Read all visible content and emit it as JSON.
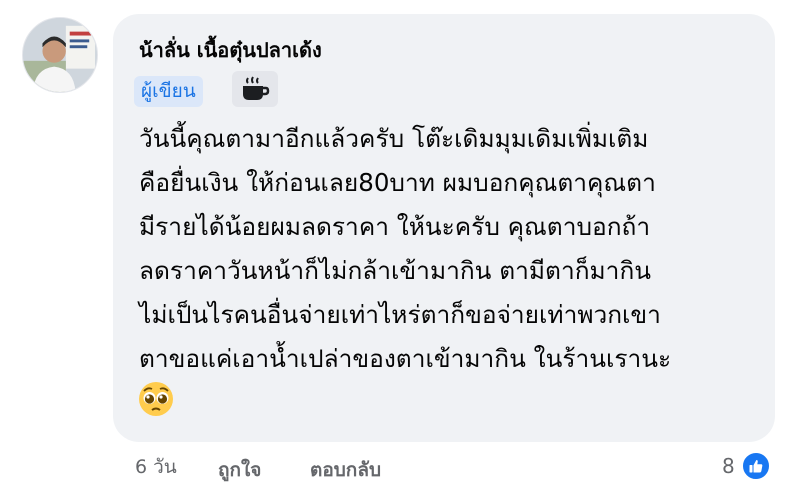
{
  "comment": {
    "author": "น้าลั่น เนื้อตุ๋นปลาเด้ง",
    "author_badge": "ผู้เขียน",
    "extra_badge_icon": "coffee-cup-icon",
    "body_lines": [
      "วันนี้คุณตามาอีกแล้วครับ โต๊ะเดิมมุมเดิมเพิ่มเติม",
      "คือยื่นเงิน ให้ก่อนเลย80บาท ผมบอกคุณตาคุณตา",
      "มีรายได้น้อยผมลดราคา ให้นะครับ คุณตาบอกถ้า",
      "ลดราคาวันหน้าก็ไม่กล้าเข้ามากิน ตามีตาก็มากิน",
      "ไม่เป็นไรคนอื่นจ่ายเท่าไหร่ตาก็ขอจ่ายเท่าพวกเขา",
      "ตาขอแค่เอาน้ำเปล่าของตาเข้ามากิน ในร้านเรานะ"
    ],
    "emoji": "pleading-face-emoji"
  },
  "footer": {
    "time": "6 วัน",
    "like_label": "ถูกใจ",
    "reply_label": "ตอบกลับ",
    "reaction_count": "8",
    "reaction_icon": "thumbs-up-icon"
  },
  "colors": {
    "bubble": "#f0f2f5",
    "badge_bg": "#dbe7f9",
    "badge_text": "#1b74e4",
    "meta_text": "#65676b",
    "like_blue": "#1877f2"
  }
}
